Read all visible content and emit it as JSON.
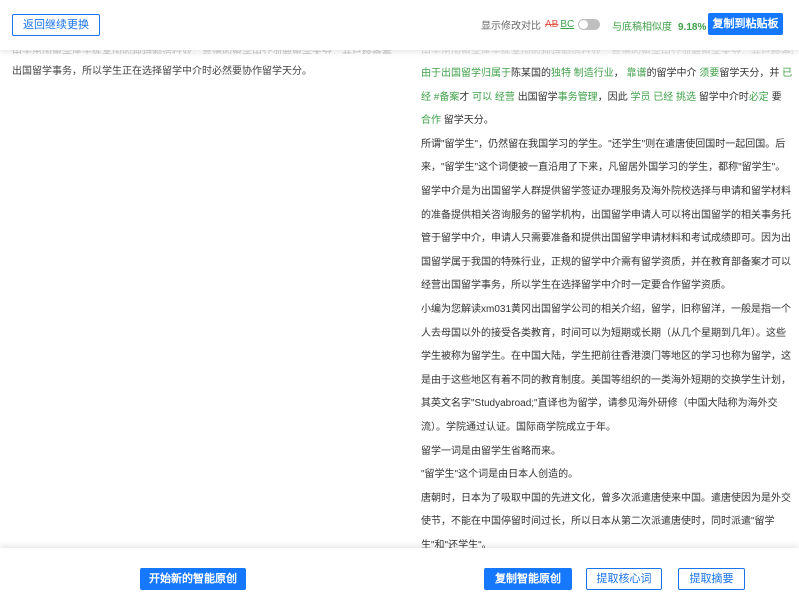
{
  "toolbar": {
    "back_button": "返回继续更换",
    "diff_label": "显示修改对比",
    "diff_removed_sample": "AB",
    "diff_added_sample": "BC",
    "diff_toggle_on": false,
    "similarity_label": "与底稿相似度",
    "similarity_value": "9.18%",
    "copy_clipboard_button": "复制到粘贴板"
  },
  "left_panel": {
    "faded_line": "由于出国留学属于陈某国的独特制造行业，靠谱的留学中介须要留学天分，并已经备案才可以经营",
    "text": "出国留学事务，所以学生正在选择留学中介时必然要协作留学天分。"
  },
  "right_panel": {
    "faded_line": "由于出国留学属于陈某国的独特制造行业，靠谱的留学中介须要留学天分，并已经备案才可以经营出国留学事务",
    "para1": {
      "s1": "由于",
      "s2": "出国留学",
      "s3": "归属于",
      "s4": "陈某国的",
      "s5": "独特",
      "s6": "制造行业",
      "s7": "，",
      "s8": "靠谱",
      "s9": "的留学中介",
      "s10": "须要",
      "s11": "留学天分，并",
      "s12": "已经",
      "s13": "#备案",
      "s14": "才",
      "s15": "可以",
      "s16": "经营",
      "s17": "出国留学",
      "s18": "事务管理",
      "s19": "，因此",
      "s20": "学员",
      "s21": "已经",
      "s22": "挑选",
      "s23": "留学中介时",
      "s24": "必定",
      "s25": "要",
      "s26": "合作",
      "s27": "留学天分。"
    },
    "para2": "所谓\"留学生\"，仍然留在我国学习的学生。\"还学生\"则在遣唐使回国时一起回国。后来，\"留学生\"这个词便被一直沿用了下来，凡留居外国学习的学生，都称\"留学生\"。留学中介是为出国留学人群提供留学签证办理服务及海外院校选择与申请和留学材料的准备提供相关咨询服务的留学机构，出国留学申请人可以将出国留学的相关事务托管于留学中介，申请人只需要准备和提供出国留学申请材料和考试成绩即可。因为出国留学属于我国的特殊行业，正规的留学中介需有留学资质，并在教育部备案才可以经营出国留学事务，所以学生在选择留学中介时一定要合作留学资质。",
    "para3": "小编为您解读xm031黄冈出国留学公司的相关介绍，留学，旧称留洋，一般是指一个人去母国以外的接受各类教育，时间可以为短期或长期（从几个星期到几年）。这些学生被称为留学生。在中国大陆，学生把前往香港澳门等地区的学习也称为留学，这是由于这些地区有着不同的教育制度。美国等组织的一类海外短期的交换学生计划，其英文名字\"Studyabroad;\"直译也为留学，请参见海外研修（中国大陆称为海外交流）。学院通过认证。国际商学院成立于年。",
    "para4": "留学一词是由留学生省略而来。",
    "para5": "\"留学生\"这个词是由日本人创造的。",
    "para6": "唐朝时，日本为了吸取中国的先进文化，曾多次派遣唐使来中国。遣唐使因为是外交使节，不能在中国停留时间过长，所以日本从第二次派遣唐使时，同时派遣\"留学生\"和\"还学生\"。"
  },
  "bottom": {
    "new_button": "开始新的智能原创",
    "copy_button": "复制智能原创",
    "keywords_button": "提取核心词",
    "summary_button": "提取摘要"
  },
  "colors": {
    "primary": "#1677ff",
    "diff_green": "#3fa04a",
    "diff_red": "#e05b4a"
  }
}
